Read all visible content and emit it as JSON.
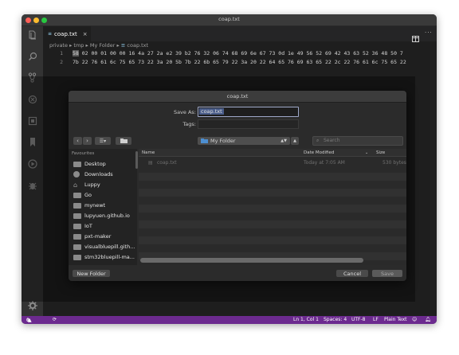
{
  "window": {
    "title": "coap.txt"
  },
  "tab": {
    "label": "coap.txt",
    "close_glyph": "×"
  },
  "breadcrumb": [
    "private",
    "tmp",
    "My Folder",
    "coap.txt"
  ],
  "editor": {
    "lines": [
      {
        "number": "1",
        "cursor_text": "58",
        "text": " 02 00 01 00 00 16 4a 27 2a e2 39 b2 76 32 06 74 68 69 6e 67 73 0d 1e 49 56 52 69 42 43 63 52 36 48 50 7"
      },
      {
        "number": "2",
        "cursor_text": "",
        "text": "7b 22 76 61 6c 75 65 73 22 3a 20 5b 7b 22 6b 65 79 22 3a 20 22 64 65 76 69 63 65 22 2c 22 76 61 6c 75 65 22"
      }
    ]
  },
  "dialog": {
    "title": "coap.txt",
    "save_as_label": "Save As:",
    "save_as_value": "coap.txt",
    "tags_label": "Tags:",
    "tags_value": "",
    "location": "My Folder",
    "search_placeholder": "Search",
    "favourites_heading": "Favourites",
    "sidebar_items": [
      {
        "label": "Desktop",
        "icon": "desktop-icon"
      },
      {
        "label": "Downloads",
        "icon": "downloads-icon"
      },
      {
        "label": "Luppy",
        "icon": "home-icon"
      },
      {
        "label": "Go",
        "icon": "folder-icon"
      },
      {
        "label": "mynewt",
        "icon": "folder-icon"
      },
      {
        "label": "lupyuen.github.io",
        "icon": "folder-icon"
      },
      {
        "label": "IoT",
        "icon": "folder-icon"
      },
      {
        "label": "pxt-maker",
        "icon": "folder-icon"
      },
      {
        "label": "visualbluepill.gith...",
        "icon": "folder-icon"
      },
      {
        "label": "stm32bluepill-ma...",
        "icon": "folder-icon"
      }
    ],
    "columns": {
      "name": "Name",
      "date": "Date Modified",
      "size": "Size"
    },
    "files": [
      {
        "name": "coap.txt",
        "date": "Today at 7:05 AM",
        "size": "530 bytes"
      }
    ],
    "new_folder_label": "New Folder",
    "cancel_label": "Cancel",
    "save_label": "Save"
  },
  "status_bar": {
    "errors": "0",
    "warnings": "0",
    "position": "Ln 1, Col 1",
    "spaces": "Spaces: 4",
    "encoding": "UTF-8",
    "eol": "LF",
    "language": "Plain Text"
  },
  "colors": {
    "status_bar": "#6c2a8f",
    "folder_icon": "#4d8fd1",
    "default_button": "#5a5a5a",
    "selection": "#4a5d8a"
  }
}
